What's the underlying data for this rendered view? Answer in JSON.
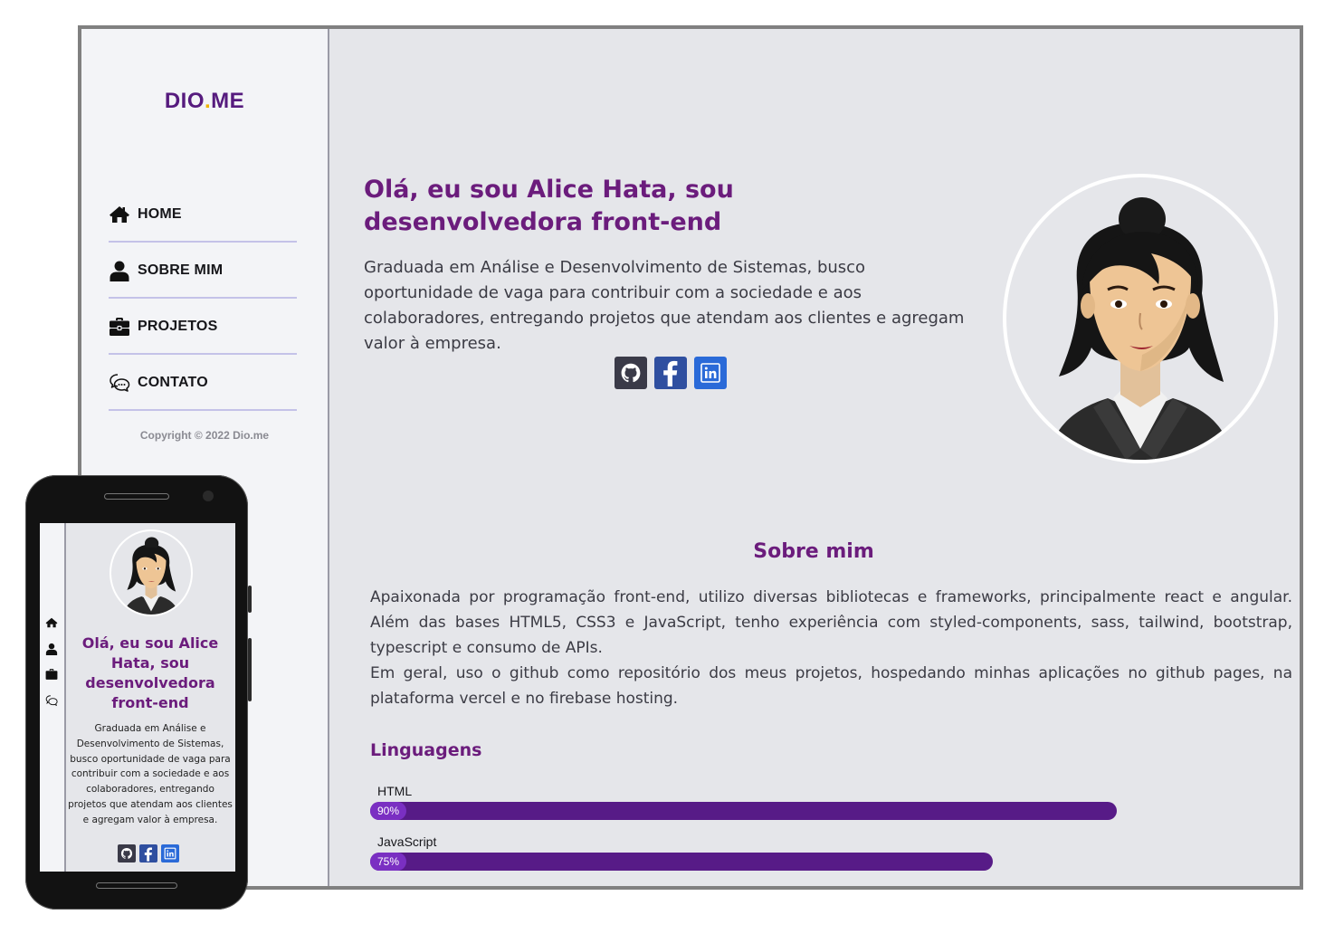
{
  "brand": {
    "logo_part1": "DIO",
    "logo_dot": ".",
    "logo_part2": "ME"
  },
  "nav": [
    {
      "label": "HOME",
      "icon": "home-icon"
    },
    {
      "label": "SOBRE MIM",
      "icon": "user-icon"
    },
    {
      "label": "PROJETOS",
      "icon": "briefcase-icon"
    },
    {
      "label": "CONTATO",
      "icon": "chat-icon"
    }
  ],
  "copyright": "Copyright © 2022 Dio.me",
  "hero": {
    "title": "Olá, eu sou Alice Hata, sou desenvolvedora front-end",
    "text": "Graduada em Análise e Desenvolvimento de Sistemas, busco oportunidade de vaga para contribuir com a sociedade e aos colaboradores, entregando projetos que atendam aos clientes e agregam valor à empresa."
  },
  "social": [
    {
      "icon": "github-icon"
    },
    {
      "icon": "facebook-icon"
    },
    {
      "icon": "linkedin-icon"
    }
  ],
  "about": {
    "title": "Sobre mim",
    "paragraphs": [
      "Apaixonada por programação front-end, utilizo diversas bibliotecas e frameworks, principalmente react e angular. Além das bases HTML5, CSS3 e JavaScript, tenho experiência com styled-components, sass, tailwind, bootstrap, typescript e consumo de APIs.",
      "Em geral, uso o github como repositório dos meus projetos, hospedando minhas aplicações no github pages, na plataforma vercel e no firebase hosting."
    ]
  },
  "languages": {
    "title": "Linguagens",
    "items": [
      {
        "name": "HTML",
        "percent_label": "90%",
        "percent": 0.9
      },
      {
        "name": "JavaScript",
        "percent_label": "75%",
        "percent": 0.75
      }
    ]
  },
  "colors": {
    "accent": "#6b1c7c",
    "bar": "#571b87",
    "logo_dot": "#f0b400",
    "nav_divider": "#c4c2e8"
  }
}
